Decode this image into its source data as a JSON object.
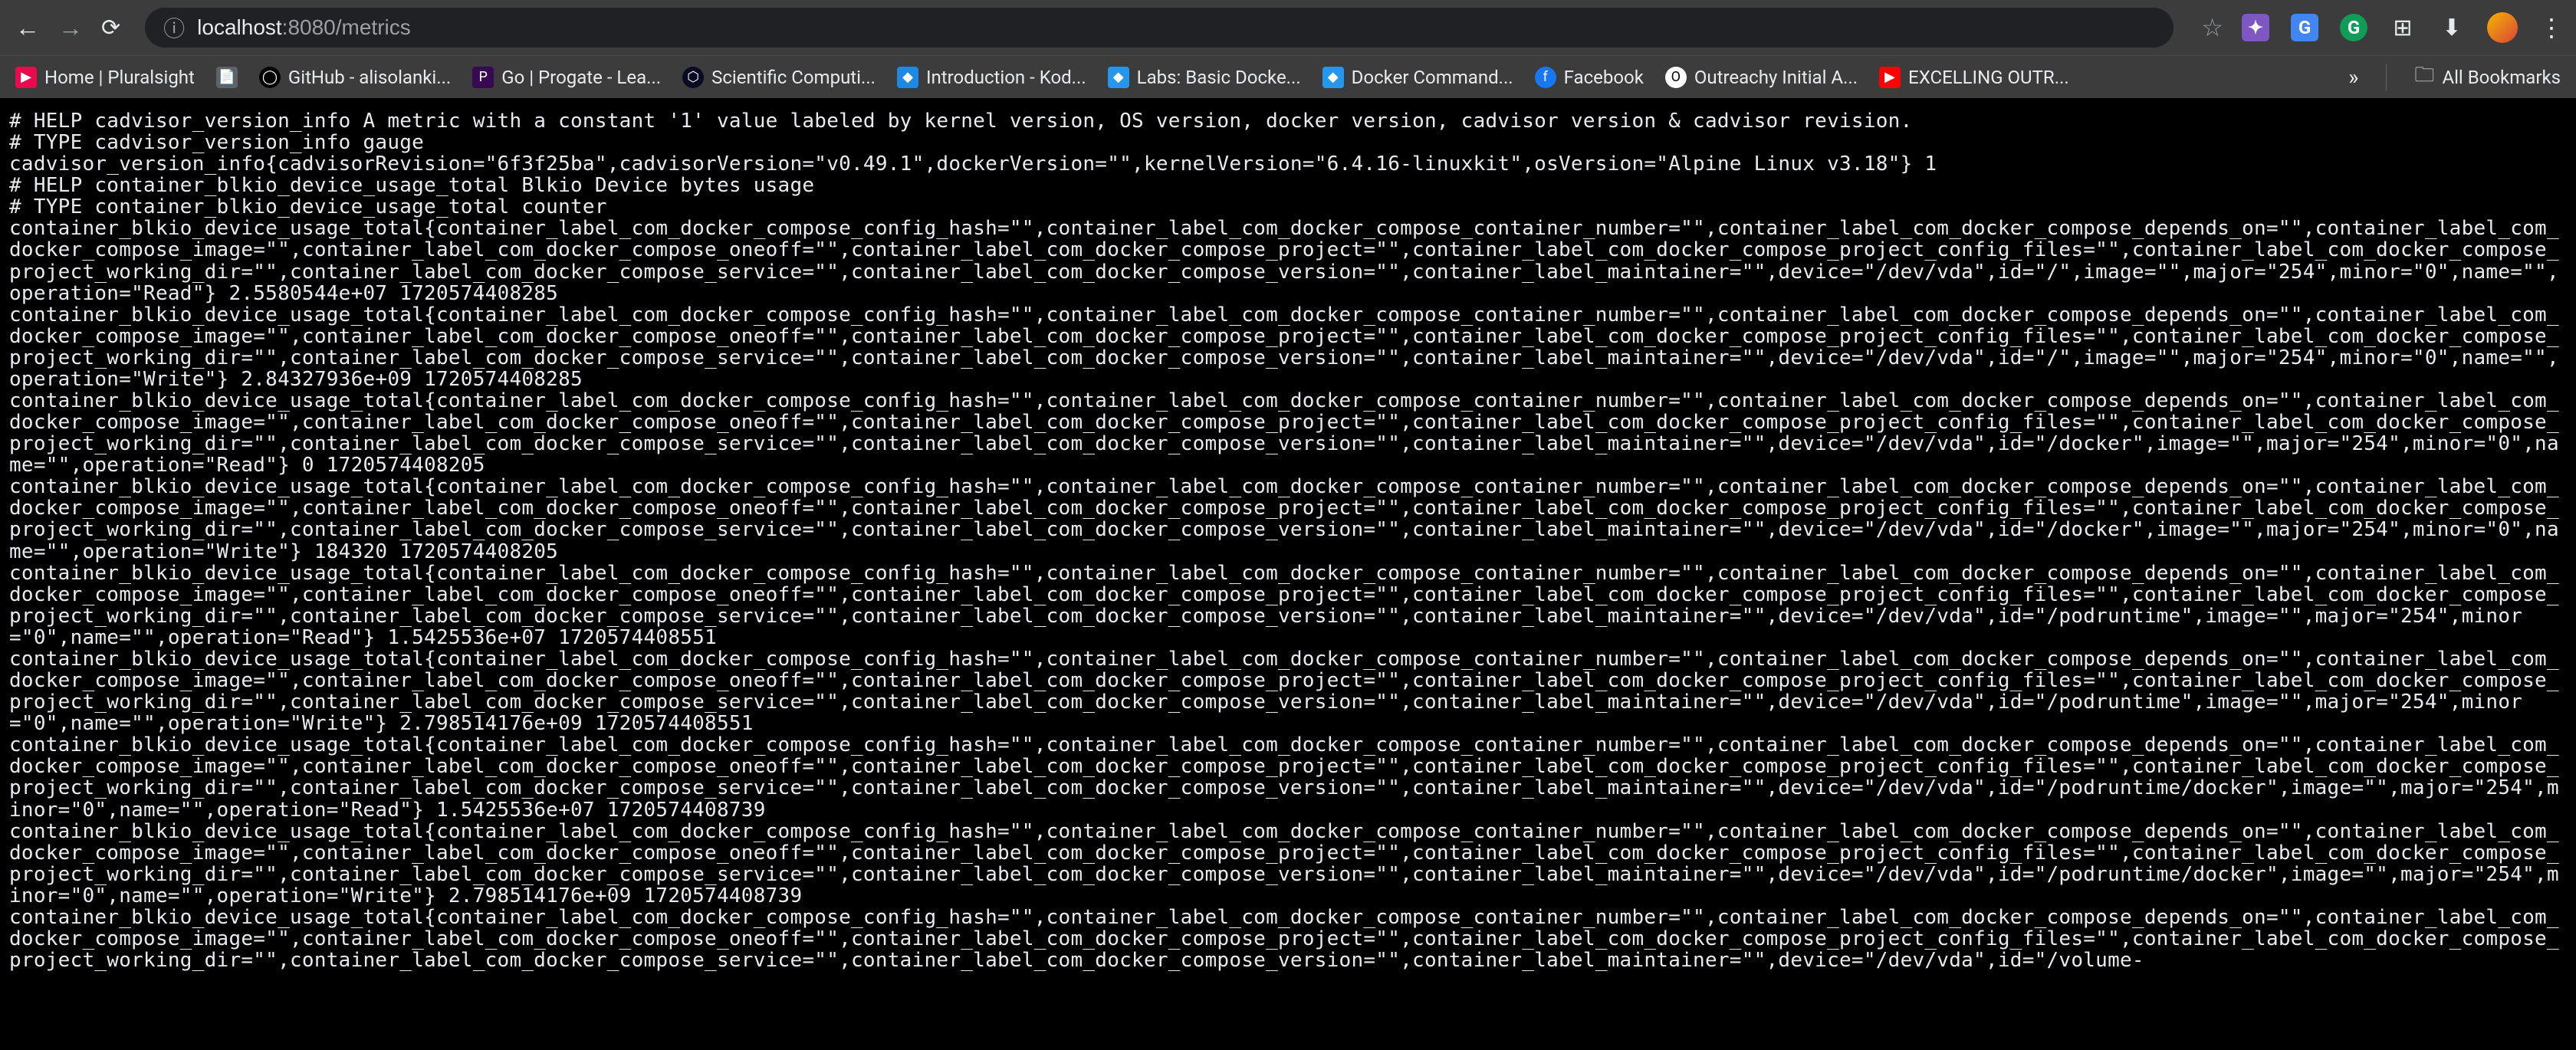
{
  "browser": {
    "url_prefix": "localhost",
    "url_port": ":8080",
    "url_path": "/metrics"
  },
  "bookmarks": [
    {
      "label": "Home | Pluralsight",
      "iconClass": "bm-pluralsight",
      "iconText": "▶"
    },
    {
      "label": "",
      "iconClass": "bm-file",
      "iconText": "📄"
    },
    {
      "label": "GitHub - alisolanki...",
      "iconClass": "bm-github",
      "iconText": "◯"
    },
    {
      "label": "Go | Progate - Lea...",
      "iconClass": "bm-progate",
      "iconText": "P"
    },
    {
      "label": "Scientific Computi...",
      "iconClass": "bm-scientific",
      "iconText": "⬡"
    },
    {
      "label": "Introduction - Kod...",
      "iconClass": "bm-kode",
      "iconText": "◆"
    },
    {
      "label": "Labs: Basic Docke...",
      "iconClass": "bm-docker",
      "iconText": "◆"
    },
    {
      "label": "Docker Command...",
      "iconClass": "bm-docker",
      "iconText": "◆"
    },
    {
      "label": "Facebook",
      "iconClass": "bm-facebook",
      "iconText": "f"
    },
    {
      "label": "Outreachy Initial A...",
      "iconClass": "bm-outreachy",
      "iconText": "O"
    },
    {
      "label": "EXCELLING OUTR...",
      "iconClass": "bm-youtube",
      "iconText": "▶"
    }
  ],
  "all_bookmarks_label": "All Bookmarks",
  "metrics_text": "# HELP cadvisor_version_info A metric with a constant '1' value labeled by kernel version, OS version, docker version, cadvisor version & cadvisor revision.\n# TYPE cadvisor_version_info gauge\ncadvisor_version_info{cadvisorRevision=\"6f3f25ba\",cadvisorVersion=\"v0.49.1\",dockerVersion=\"\",kernelVersion=\"6.4.16-linuxkit\",osVersion=\"Alpine Linux v3.18\"} 1\n# HELP container_blkio_device_usage_total Blkio Device bytes usage\n# TYPE container_blkio_device_usage_total counter\ncontainer_blkio_device_usage_total{container_label_com_docker_compose_config_hash=\"\",container_label_com_docker_compose_container_number=\"\",container_label_com_docker_compose_depends_on=\"\",container_label_com_docker_compose_image=\"\",container_label_com_docker_compose_oneoff=\"\",container_label_com_docker_compose_project=\"\",container_label_com_docker_compose_project_config_files=\"\",container_label_com_docker_compose_project_working_dir=\"\",container_label_com_docker_compose_service=\"\",container_label_com_docker_compose_version=\"\",container_label_maintainer=\"\",device=\"/dev/vda\",id=\"/\",image=\"\",major=\"254\",minor=\"0\",name=\"\",operation=\"Read\"} 2.5580544e+07 1720574408285\ncontainer_blkio_device_usage_total{container_label_com_docker_compose_config_hash=\"\",container_label_com_docker_compose_container_number=\"\",container_label_com_docker_compose_depends_on=\"\",container_label_com_docker_compose_image=\"\",container_label_com_docker_compose_oneoff=\"\",container_label_com_docker_compose_project=\"\",container_label_com_docker_compose_project_config_files=\"\",container_label_com_docker_compose_project_working_dir=\"\",container_label_com_docker_compose_service=\"\",container_label_com_docker_compose_version=\"\",container_label_maintainer=\"\",device=\"/dev/vda\",id=\"/\",image=\"\",major=\"254\",minor=\"0\",name=\"\",operation=\"Write\"} 2.84327936e+09 1720574408285\ncontainer_blkio_device_usage_total{container_label_com_docker_compose_config_hash=\"\",container_label_com_docker_compose_container_number=\"\",container_label_com_docker_compose_depends_on=\"\",container_label_com_docker_compose_image=\"\",container_label_com_docker_compose_oneoff=\"\",container_label_com_docker_compose_project=\"\",container_label_com_docker_compose_project_config_files=\"\",container_label_com_docker_compose_project_working_dir=\"\",container_label_com_docker_compose_service=\"\",container_label_com_docker_compose_version=\"\",container_label_maintainer=\"\",device=\"/dev/vda\",id=\"/docker\",image=\"\",major=\"254\",minor=\"0\",name=\"\",operation=\"Read\"} 0 1720574408205\ncontainer_blkio_device_usage_total{container_label_com_docker_compose_config_hash=\"\",container_label_com_docker_compose_container_number=\"\",container_label_com_docker_compose_depends_on=\"\",container_label_com_docker_compose_image=\"\",container_label_com_docker_compose_oneoff=\"\",container_label_com_docker_compose_project=\"\",container_label_com_docker_compose_project_config_files=\"\",container_label_com_docker_compose_project_working_dir=\"\",container_label_com_docker_compose_service=\"\",container_label_com_docker_compose_version=\"\",container_label_maintainer=\"\",device=\"/dev/vda\",id=\"/docker\",image=\"\",major=\"254\",minor=\"0\",name=\"\",operation=\"Write\"} 184320 1720574408205\ncontainer_blkio_device_usage_total{container_label_com_docker_compose_config_hash=\"\",container_label_com_docker_compose_container_number=\"\",container_label_com_docker_compose_depends_on=\"\",container_label_com_docker_compose_image=\"\",container_label_com_docker_compose_oneoff=\"\",container_label_com_docker_compose_project=\"\",container_label_com_docker_compose_project_config_files=\"\",container_label_com_docker_compose_project_working_dir=\"\",container_label_com_docker_compose_service=\"\",container_label_com_docker_compose_version=\"\",container_label_maintainer=\"\",device=\"/dev/vda\",id=\"/podruntime\",image=\"\",major=\"254\",minor=\"0\",name=\"\",operation=\"Read\"} 1.5425536e+07 1720574408551\ncontainer_blkio_device_usage_total{container_label_com_docker_compose_config_hash=\"\",container_label_com_docker_compose_container_number=\"\",container_label_com_docker_compose_depends_on=\"\",container_label_com_docker_compose_image=\"\",container_label_com_docker_compose_oneoff=\"\",container_label_com_docker_compose_project=\"\",container_label_com_docker_compose_project_config_files=\"\",container_label_com_docker_compose_project_working_dir=\"\",container_label_com_docker_compose_service=\"\",container_label_com_docker_compose_version=\"\",container_label_maintainer=\"\",device=\"/dev/vda\",id=\"/podruntime\",image=\"\",major=\"254\",minor=\"0\",name=\"\",operation=\"Write\"} 2.798514176e+09 1720574408551\ncontainer_blkio_device_usage_total{container_label_com_docker_compose_config_hash=\"\",container_label_com_docker_compose_container_number=\"\",container_label_com_docker_compose_depends_on=\"\",container_label_com_docker_compose_image=\"\",container_label_com_docker_compose_oneoff=\"\",container_label_com_docker_compose_project=\"\",container_label_com_docker_compose_project_config_files=\"\",container_label_com_docker_compose_project_working_dir=\"\",container_label_com_docker_compose_service=\"\",container_label_com_docker_compose_version=\"\",container_label_maintainer=\"\",device=\"/dev/vda\",id=\"/podruntime/docker\",image=\"\",major=\"254\",minor=\"0\",name=\"\",operation=\"Read\"} 1.5425536e+07 1720574408739\ncontainer_blkio_device_usage_total{container_label_com_docker_compose_config_hash=\"\",container_label_com_docker_compose_container_number=\"\",container_label_com_docker_compose_depends_on=\"\",container_label_com_docker_compose_image=\"\",container_label_com_docker_compose_oneoff=\"\",container_label_com_docker_compose_project=\"\",container_label_com_docker_compose_project_config_files=\"\",container_label_com_docker_compose_project_working_dir=\"\",container_label_com_docker_compose_service=\"\",container_label_com_docker_compose_version=\"\",container_label_maintainer=\"\",device=\"/dev/vda\",id=\"/podruntime/docker\",image=\"\",major=\"254\",minor=\"0\",name=\"\",operation=\"Write\"} 2.798514176e+09 1720574408739\ncontainer_blkio_device_usage_total{container_label_com_docker_compose_config_hash=\"\",container_label_com_docker_compose_container_number=\"\",container_label_com_docker_compose_depends_on=\"\",container_label_com_docker_compose_image=\"\",container_label_com_docker_compose_oneoff=\"\",container_label_com_docker_compose_project=\"\",container_label_com_docker_compose_project_config_files=\"\",container_label_com_docker_compose_project_working_dir=\"\",container_label_com_docker_compose_service=\"\",container_label_com_docker_compose_version=\"\",container_label_maintainer=\"\",device=\"/dev/vda\",id=\"/volume-"
}
